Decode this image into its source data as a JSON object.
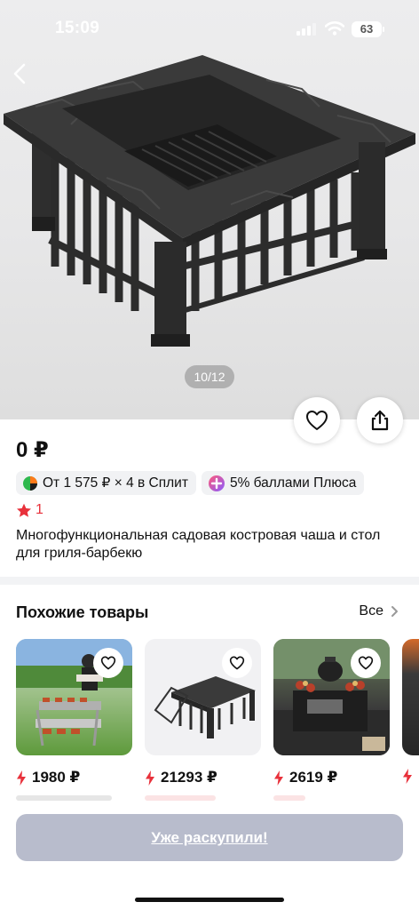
{
  "status_bar": {
    "time": "15:09",
    "battery": "63"
  },
  "gallery": {
    "counter": "10/12"
  },
  "product": {
    "price": "0 ₽",
    "split_text": "От 1 575 ₽ × 4 в Сплит",
    "plus_text": "5% баллами Плюса",
    "rating": "1",
    "title": "Многофункциональная садовая костровая чаша и стол для гриля-барбекю"
  },
  "similar": {
    "heading": "Похожие товары",
    "all_label": "Все",
    "items": [
      {
        "price": "1980 ₽"
      },
      {
        "price": "21293 ₽"
      },
      {
        "price": "2619 ₽"
      },
      {
        "price": ""
      }
    ]
  },
  "cta": {
    "label": "Уже раскупили!"
  },
  "colors": {
    "accent_red": "#e8313b",
    "cta_bg": "#b8bccc",
    "split_green": "#2fb84d",
    "plus_purple": "#b45cff"
  }
}
